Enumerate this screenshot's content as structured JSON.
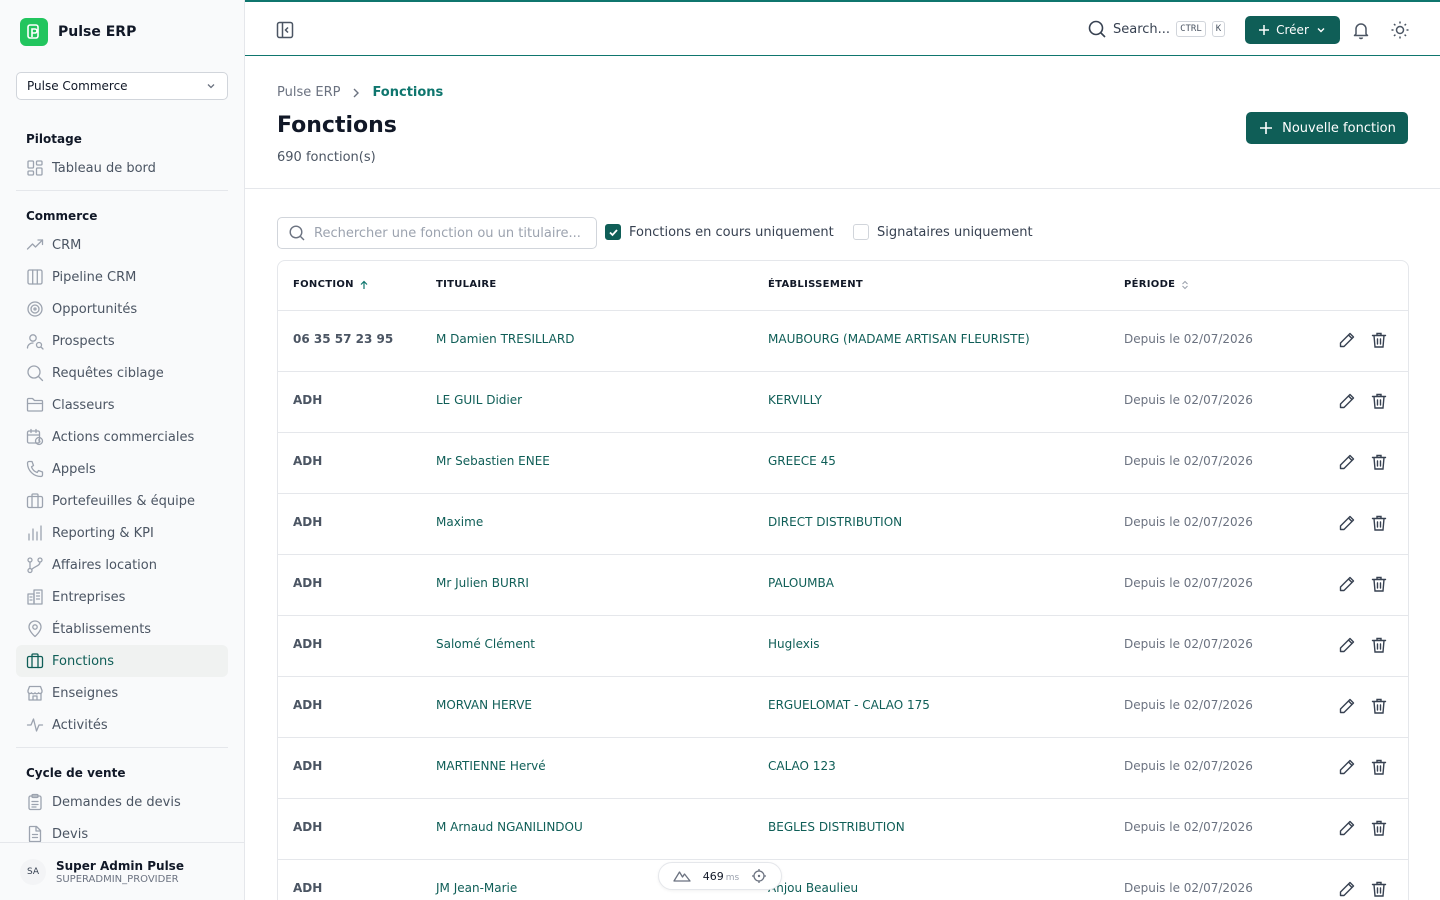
{
  "app": {
    "name": "Pulse ERP",
    "org": "Pulse Commerce"
  },
  "sidebar": {
    "sections": [
      {
        "title": "Pilotage",
        "items": [
          {
            "label": "Tableau de bord",
            "icon": "dashboard-icon"
          }
        ]
      },
      {
        "title": "Commerce",
        "items": [
          {
            "label": "CRM",
            "icon": "trending-icon"
          },
          {
            "label": "Pipeline CRM",
            "icon": "kanban-icon"
          },
          {
            "label": "Opportunités",
            "icon": "target-icon"
          },
          {
            "label": "Prospects",
            "icon": "user-search-icon"
          },
          {
            "label": "Requêtes ciblage",
            "icon": "search-icon"
          },
          {
            "label": "Classeurs",
            "icon": "folder-icon"
          },
          {
            "label": "Actions commerciales",
            "icon": "calendar-clock-icon"
          },
          {
            "label": "Appels",
            "icon": "phone-icon"
          },
          {
            "label": "Portefeuilles & équipe",
            "icon": "briefcase-icon"
          },
          {
            "label": "Reporting & KPI",
            "icon": "bar-chart-icon"
          },
          {
            "label": "Affaires location",
            "icon": "git-branch-icon"
          },
          {
            "label": "Entreprises",
            "icon": "building-icon"
          },
          {
            "label": "Établissements",
            "icon": "map-pin-icon"
          },
          {
            "label": "Fonctions",
            "icon": "briefcase-icon",
            "active": true
          },
          {
            "label": "Enseignes",
            "icon": "store-icon"
          },
          {
            "label": "Activités",
            "icon": "activity-icon"
          }
        ]
      },
      {
        "title": "Cycle de vente",
        "items": [
          {
            "label": "Demandes de devis",
            "icon": "clipboard-icon"
          },
          {
            "label": "Devis",
            "icon": "file-icon"
          }
        ]
      }
    ],
    "user": {
      "initials": "SA",
      "name": "Super Admin Pulse",
      "role": "SUPERADMIN_PROVIDER"
    }
  },
  "topbar": {
    "search_label": "Search...",
    "kbd_ctrl": "CTRL",
    "kbd_k": "K",
    "create_label": "Créer"
  },
  "header": {
    "breadcrumb_root": "Pulse ERP",
    "breadcrumb_current": "Fonctions",
    "title": "Fonctions",
    "count": "690 fonction(s)",
    "new_button": "Nouvelle fonction"
  },
  "filters": {
    "search_placeholder": "Rechercher une fonction ou un titulaire...",
    "current_only_label": "Fonctions en cours uniquement",
    "current_only_checked": true,
    "signatories_label": "Signataires uniquement",
    "signatories_checked": false
  },
  "table": {
    "columns": [
      "FONCTION",
      "TITULAIRE",
      "ÉTABLISSEMENT",
      "PÉRIODE"
    ],
    "rows": [
      {
        "fonction": "06 35 57 23 95",
        "titulaire": "M Damien TRESILLARD",
        "etablissement": "MAUBOURG (MADAME ARTISAN FLEURISTE)",
        "periode": "Depuis le 02/07/2026"
      },
      {
        "fonction": "ADH",
        "titulaire": "LE GUIL Didier",
        "etablissement": "KERVILLY",
        "periode": "Depuis le 02/07/2026"
      },
      {
        "fonction": "ADH",
        "titulaire": "Mr Sebastien ENEE",
        "etablissement": "GREECE 45",
        "periode": "Depuis le 02/07/2026"
      },
      {
        "fonction": "ADH",
        "titulaire": "Maxime",
        "etablissement": "DIRECT DISTRIBUTION",
        "periode": "Depuis le 02/07/2026"
      },
      {
        "fonction": "ADH",
        "titulaire": "Mr Julien BURRI",
        "etablissement": "PALOUMBA",
        "periode": "Depuis le 02/07/2026"
      },
      {
        "fonction": "ADH",
        "titulaire": "Salomé Clément",
        "etablissement": "Huglexis",
        "periode": "Depuis le 02/07/2026"
      },
      {
        "fonction": "ADH",
        "titulaire": "MORVAN HERVE",
        "etablissement": "ERGUELOMAT - CALAO 175",
        "periode": "Depuis le 02/07/2026"
      },
      {
        "fonction": "ADH",
        "titulaire": "MARTIENNE Hervé",
        "etablissement": "CALAO 123",
        "periode": "Depuis le 02/07/2026"
      },
      {
        "fonction": "ADH",
        "titulaire": "M Arnaud NGANILINDOU",
        "etablissement": "BEGLES DISTRIBUTION",
        "periode": "Depuis le 02/07/2026"
      },
      {
        "fonction": "ADH",
        "titulaire": "JM Jean-Marie",
        "etablissement": "Anjou Beaulieu",
        "periode": "Depuis le 02/07/2026"
      }
    ]
  },
  "perf": {
    "value": "469",
    "unit": "ms"
  },
  "colors": {
    "primary": "#0f5e57",
    "accent_border": "#0f766e",
    "brand_logo": "#22c55e"
  }
}
